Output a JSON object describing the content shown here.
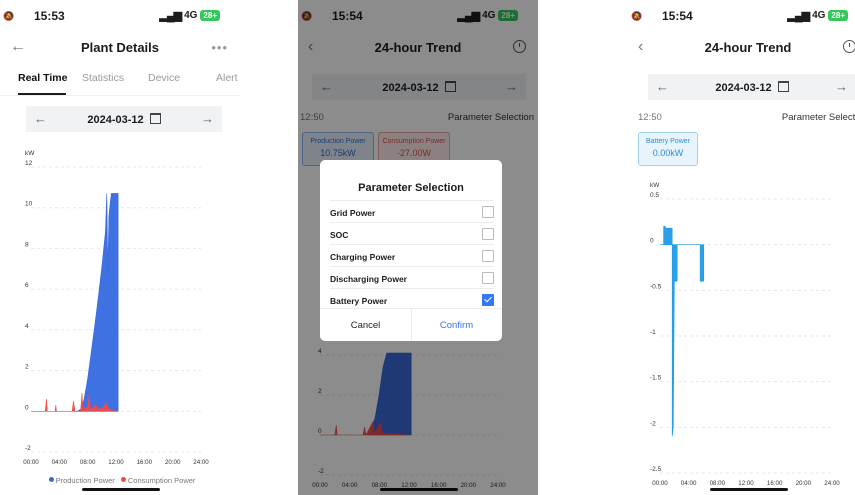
{
  "screens": [
    {
      "status": {
        "time": "15:53",
        "network": "4G",
        "battery": "28+"
      },
      "header": {
        "title": "Plant Details"
      },
      "tabs": [
        "Real Time",
        "Statistics",
        "Device",
        "Alert"
      ],
      "date": "2024-03-12",
      "chart_data": {
        "type": "area",
        "unit": "kW",
        "x_ticks": [
          "00:00",
          "04:00",
          "08:00",
          "12:00",
          "16:00",
          "20:00",
          "24:00"
        ],
        "y_ticks": [
          "-2",
          "0",
          "2",
          "4",
          "6",
          "8",
          "10",
          "12"
        ],
        "ylim": [
          -2,
          12
        ],
        "series": [
          {
            "name": "Production Power",
            "color": "#3569e0",
            "points": [
              [
                6.5,
                0
              ],
              [
                7.0,
                0.1
              ],
              [
                7.5,
                0.6
              ],
              [
                8.0,
                1.6
              ],
              [
                8.5,
                2.9
              ],
              [
                9.0,
                4.2
              ],
              [
                9.5,
                5.6
              ],
              [
                10.0,
                7.1
              ],
              [
                10.5,
                8.8
              ],
              [
                10.7,
                10.7
              ],
              [
                10.85,
                6.8
              ],
              [
                11.0,
                9.6
              ],
              [
                11.2,
                10.3
              ],
              [
                11.35,
                10.7
              ],
              [
                11.5,
                10.7
              ],
              [
                12.3,
                10.7
              ],
              [
                12.3,
                0
              ]
            ]
          },
          {
            "name": "Consumption Power",
            "color": "#ef4a4a",
            "points": [
              [
                0,
                0
              ],
              [
                2.0,
                0
              ],
              [
                2.2,
                0.6
              ],
              [
                2.3,
                0
              ],
              [
                3.4,
                0
              ],
              [
                3.5,
                0.3
              ],
              [
                3.6,
                0
              ],
              [
                5.8,
                0
              ],
              [
                6.0,
                0.5
              ],
              [
                6.2,
                0
              ],
              [
                7.0,
                0
              ],
              [
                7.2,
                0.9
              ],
              [
                7.3,
                0.1
              ],
              [
                8.0,
                0.2
              ],
              [
                8.2,
                0.8
              ],
              [
                8.4,
                0.1
              ],
              [
                9.2,
                0.3
              ],
              [
                9.5,
                0.1
              ],
              [
                10.2,
                0.2
              ],
              [
                10.6,
                0.4
              ],
              [
                11.0,
                0.1
              ],
              [
                12.0,
                0
              ]
            ]
          }
        ]
      },
      "legend": [
        "Production Power",
        "Consumption Power"
      ]
    },
    {
      "status": {
        "time": "15:54",
        "network": "4G",
        "battery": "28+"
      },
      "header": {
        "title": "24-hour Trend"
      },
      "date": "2024-03-12",
      "time_label": "12:50",
      "param_link": "Parameter Selection",
      "cards": [
        {
          "name": "Production Power",
          "value": "10.75kW"
        },
        {
          "name": "Consumption Power",
          "value": "-27.00W"
        }
      ],
      "dialog": {
        "title": "Parameter Selection",
        "options": [
          {
            "label": "Grid Power",
            "checked": false
          },
          {
            "label": "SOC",
            "checked": false
          },
          {
            "label": "Charging Power",
            "checked": false
          },
          {
            "label": "Discharging Power",
            "checked": false
          },
          {
            "label": "Battery Power",
            "checked": true
          }
        ],
        "cancel": "Cancel",
        "confirm": "Confirm"
      },
      "chart_data": {
        "type": "area",
        "x_ticks": [
          "00:00",
          "04:00",
          "08:00",
          "12:00",
          "16:00",
          "20:00",
          "24:00"
        ],
        "y_ticks": [
          "-2",
          "0",
          "2",
          "4"
        ],
        "ylim": [
          -2,
          4
        ],
        "series": [
          {
            "name": "Production Power",
            "color": "#2e5fd6",
            "points": [
              [
                6.5,
                0
              ],
              [
                7.0,
                0.2
              ],
              [
                7.5,
                1.0
              ],
              [
                8.0,
                2.1
              ],
              [
                8.5,
                3.4
              ],
              [
                9.0,
                4.1
              ],
              [
                10.0,
                4.1
              ],
              [
                12.3,
                4.1
              ],
              [
                12.3,
                0
              ]
            ]
          },
          {
            "name": "Consumption Power",
            "color": "#ef4a4a",
            "points": [
              [
                0,
                0
              ],
              [
                2.0,
                0
              ],
              [
                2.2,
                0.5
              ],
              [
                2.3,
                0
              ],
              [
                5.8,
                0
              ],
              [
                6.0,
                0.4
              ],
              [
                6.2,
                0
              ],
              [
                7.2,
                0.7
              ],
              [
                7.3,
                0.1
              ],
              [
                8.2,
                0.6
              ],
              [
                8.4,
                0.1
              ],
              [
                12.0,
                0
              ]
            ]
          }
        ]
      }
    },
    {
      "status": {
        "time": "15:54",
        "network": "4G",
        "battery": "28+"
      },
      "header": {
        "title": "24-hour Trend"
      },
      "date": "2024-03-12",
      "time_label": "12:50",
      "param_link": "Parameter Selection",
      "cards": [
        {
          "name": "Battery Power",
          "value": "0.00kW"
        }
      ],
      "chart_data": {
        "type": "bar",
        "unit": "kW",
        "x_ticks": [
          "00:00",
          "04:00",
          "08:00",
          "12:00",
          "16:00",
          "20:00",
          "24:00"
        ],
        "y_ticks": [
          "0.5",
          "0",
          "-0.5",
          "-1",
          "-1.5",
          "-2",
          "-2.5"
        ],
        "ylim": [
          -2.5,
          0.5
        ],
        "series": [
          {
            "name": "Battery Power",
            "color": "#1e9be6",
            "points": [
              [
                0,
                0
              ],
              [
                0.5,
                0
              ],
              [
                0.5,
                0.2
              ],
              [
                0.75,
                0.2
              ],
              [
                0.75,
                0.18
              ],
              [
                1.7,
                0.18
              ],
              [
                1.7,
                -2.1
              ],
              [
                1.85,
                -2.0
              ],
              [
                2.0,
                -0.4
              ],
              [
                2.4,
                -0.4
              ],
              [
                2.4,
                0
              ],
              [
                5.6,
                0
              ],
              [
                5.6,
                -0.4
              ],
              [
                6.1,
                -0.4
              ],
              [
                6.1,
                0
              ]
            ]
          }
        ]
      }
    }
  ]
}
